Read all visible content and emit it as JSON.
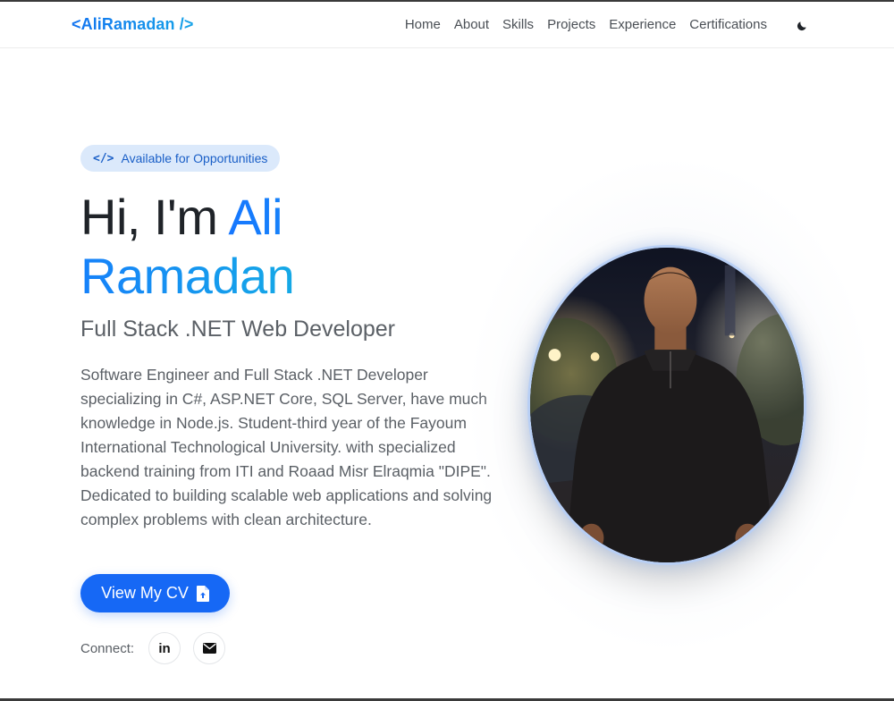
{
  "nav": {
    "brand": "<AliRamadan />",
    "links": [
      "Home",
      "About",
      "Skills",
      "Projects",
      "Experience",
      "Certifications"
    ],
    "theme_icon": "moon-icon"
  },
  "hero": {
    "badge_icon": "</>",
    "badge": "Available for Opportunities",
    "greeting": "Hi, I'm ",
    "name": "Ali Ramadan",
    "subtitle": "Full Stack .NET Web Developer",
    "description": "Software Engineer and Full Stack .NET Developer specializing in C#, ASP.NET Core, SQL Server, have much knowledge in Node.js. Student-third year of the Fayoum International Technological University. with specialized backend training from ITI and Roaad Misr Elraqmia \"DIPE\". Dedicated to building scalable web applications and solving complex problems with clean architecture.",
    "cv_button": "View My CV",
    "connect_label": "Connect:",
    "social": [
      {
        "name": "linkedin-icon",
        "glyph": "in"
      },
      {
        "name": "email-icon"
      }
    ]
  },
  "colors": {
    "accent": "#1668f5",
    "accent_light": "#15a9e6",
    "badge_bg": "#dbe9fb",
    "text": "#1f2328",
    "muted": "#5b6066"
  }
}
